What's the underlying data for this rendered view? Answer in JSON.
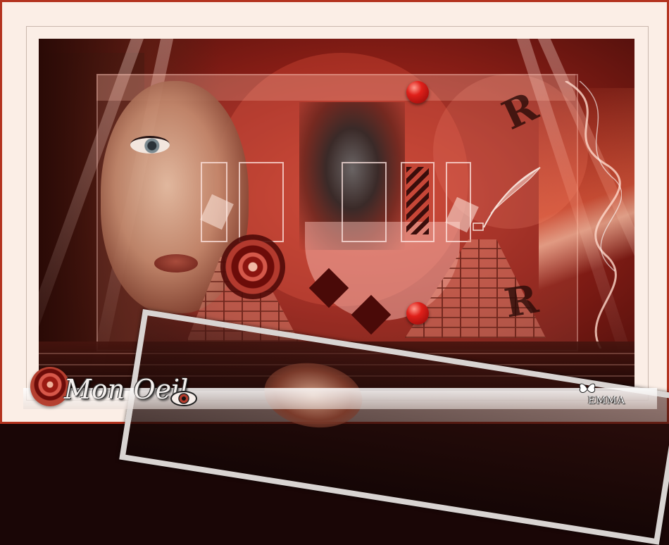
{
  "title_text": "Mon Oeil",
  "signature": "EMMA",
  "colors": {
    "frame_border": "#b3331f",
    "frame_background": "#fbeee6",
    "dominant_red": "#8e1f17",
    "accent_red": "#e0201a"
  },
  "icons": {
    "eye": "eye-icon",
    "butterfly": "butterfly-icon",
    "rose": "rose-icon"
  }
}
